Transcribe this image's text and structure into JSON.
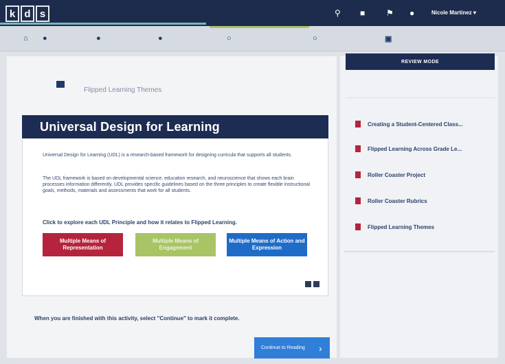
{
  "header": {
    "logo_letters": [
      "k",
      "d",
      "s"
    ],
    "user_name": "Nicole Martinez",
    "top_icons": [
      "search-icon",
      "bookmark-icon",
      "flag-icon",
      "help-icon"
    ]
  },
  "page": {
    "title": "Flipped Learning Themes",
    "card_title": "Universal Design for Learning",
    "paragraph1": "Universal Design for Learning (UDL) is a research-based framework for designing curricula that supports all students.",
    "paragraph2": "The UDL framework is based on developmental science, education research, and neuroscience that shows each brain processes information differently. UDL provides specific guidelines based on the three principles to create flexible instructional goals, methods, materials and assessments that work for all students.",
    "cta": "Click to explore each UDL Principle and how it relates to Flipped Learning.",
    "buttons": [
      {
        "label": "Multiple Means of Representation"
      },
      {
        "label": "Multiple Means of Engagement"
      },
      {
        "label": "Multiple Means of Action and Expression"
      }
    ],
    "finish_text": "When you are finished with this activity, select \"Continue\" to mark it complete.",
    "continue_label": "Continue to Reading"
  },
  "sidebar": {
    "review_mode": "REVIEW MODE",
    "items": [
      {
        "label": "Creating a Student-Centered Class..."
      },
      {
        "label": "Flipped Learning Across Grade Le..."
      },
      {
        "label": "Roller Coaster Project"
      },
      {
        "label": "Roller Coaster Rubrics"
      },
      {
        "label": "Flipped Learning Themes"
      }
    ]
  },
  "colors": {
    "navy": "#1d2c52",
    "red": "#b5243c",
    "green": "#a9c465",
    "blue": "#1f6cc8",
    "continue_blue": "#2f7fd9"
  }
}
